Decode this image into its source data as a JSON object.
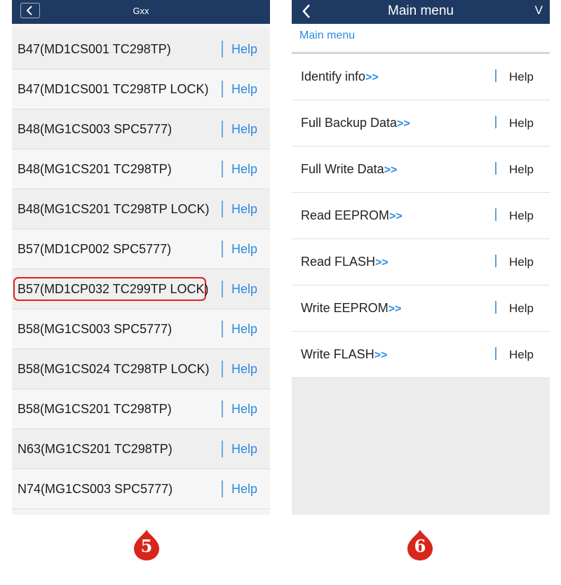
{
  "left_screen": {
    "title": "Gxx",
    "back_icon": "chevron-left-icon",
    "items": [
      {
        "label": "B47(MD1CS001 TC298TP)",
        "help": "Help"
      },
      {
        "label": "B47(MD1CS001 TC298TP LOCK)",
        "help": "Help"
      },
      {
        "label": "B48(MG1CS003 SPC5777)",
        "help": "Help"
      },
      {
        "label": "B48(MG1CS201 TC298TP)",
        "help": "Help"
      },
      {
        "label": "B48(MG1CS201 TC298TP LOCK)",
        "help": "Help"
      },
      {
        "label": "B57(MD1CP002 SPC5777)",
        "help": "Help"
      },
      {
        "label": "B57(MD1CP032 TC299TP LOCK)",
        "help": "Help",
        "highlighted": true
      },
      {
        "label": "B58(MG1CS003 SPC5777)",
        "help": "Help"
      },
      {
        "label": "B58(MG1CS024 TC298TP LOCK)",
        "help": "Help"
      },
      {
        "label": "B58(MG1CS201 TC298TP)",
        "help": "Help"
      },
      {
        "label": "N63(MG1CS201 TC298TP)",
        "help": "Help"
      },
      {
        "label": "N74(MG1CS003 SPC5777)",
        "help": "Help"
      }
    ],
    "step_badge": "5"
  },
  "right_screen": {
    "title": "Main menu",
    "right_label": "V",
    "back_icon": "chevron-left-icon",
    "breadcrumb": "Main menu",
    "arrows": ">>",
    "items": [
      {
        "label": "Identify info",
        "help": "Help"
      },
      {
        "label": "Full Backup Data",
        "help": "Help"
      },
      {
        "label": "Full Write Data",
        "help": "Help"
      },
      {
        "label": "Read EEPROM",
        "help": "Help"
      },
      {
        "label": "Read FLASH",
        "help": "Help"
      },
      {
        "label": "Write EEPROM",
        "help": "Help"
      },
      {
        "label": "Write FLASH",
        "help": "Help"
      }
    ],
    "step_badge": "6"
  },
  "colors": {
    "topbar": "#1e3a63",
    "link_blue": "#2d8ae0",
    "highlight_red": "#e02020",
    "badge_red": "#d9261c"
  }
}
